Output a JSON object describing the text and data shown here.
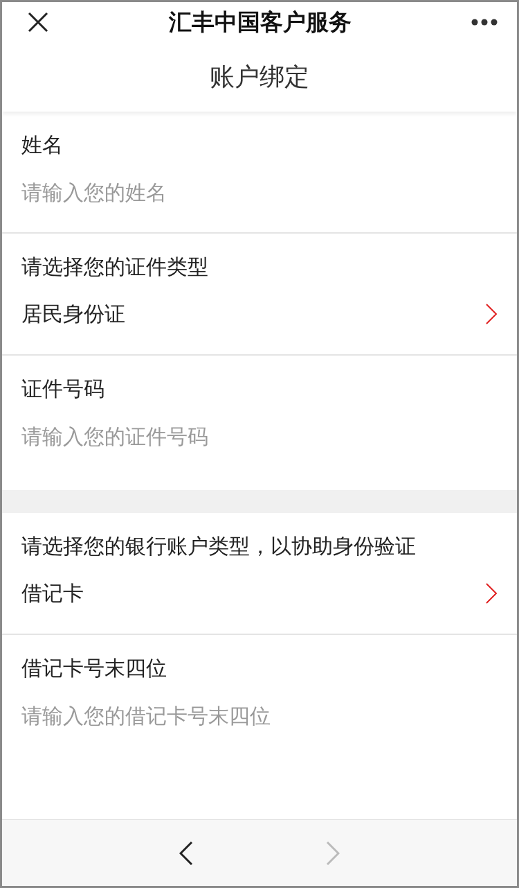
{
  "header": {
    "title": "汇丰中国客户服务",
    "subtitle": "账户绑定"
  },
  "groups": [
    {
      "fields": [
        {
          "kind": "input",
          "label": "姓名",
          "placeholder": "请输入您的姓名"
        },
        {
          "kind": "select",
          "label": "请选择您的证件类型",
          "value": "居民身份证"
        },
        {
          "kind": "input",
          "label": "证件号码",
          "placeholder": "请输入您的证件号码"
        }
      ]
    },
    {
      "fields": [
        {
          "kind": "select",
          "label": "请选择您的银行账户类型，以协助身份验证",
          "value": "借记卡"
        },
        {
          "kind": "input",
          "label": "借记卡号末四位",
          "placeholder": "请输入您的借记卡号末四位"
        }
      ]
    }
  ],
  "bottom_nav": {
    "back": {
      "disabled": false
    },
    "forward": {
      "disabled": true
    }
  }
}
